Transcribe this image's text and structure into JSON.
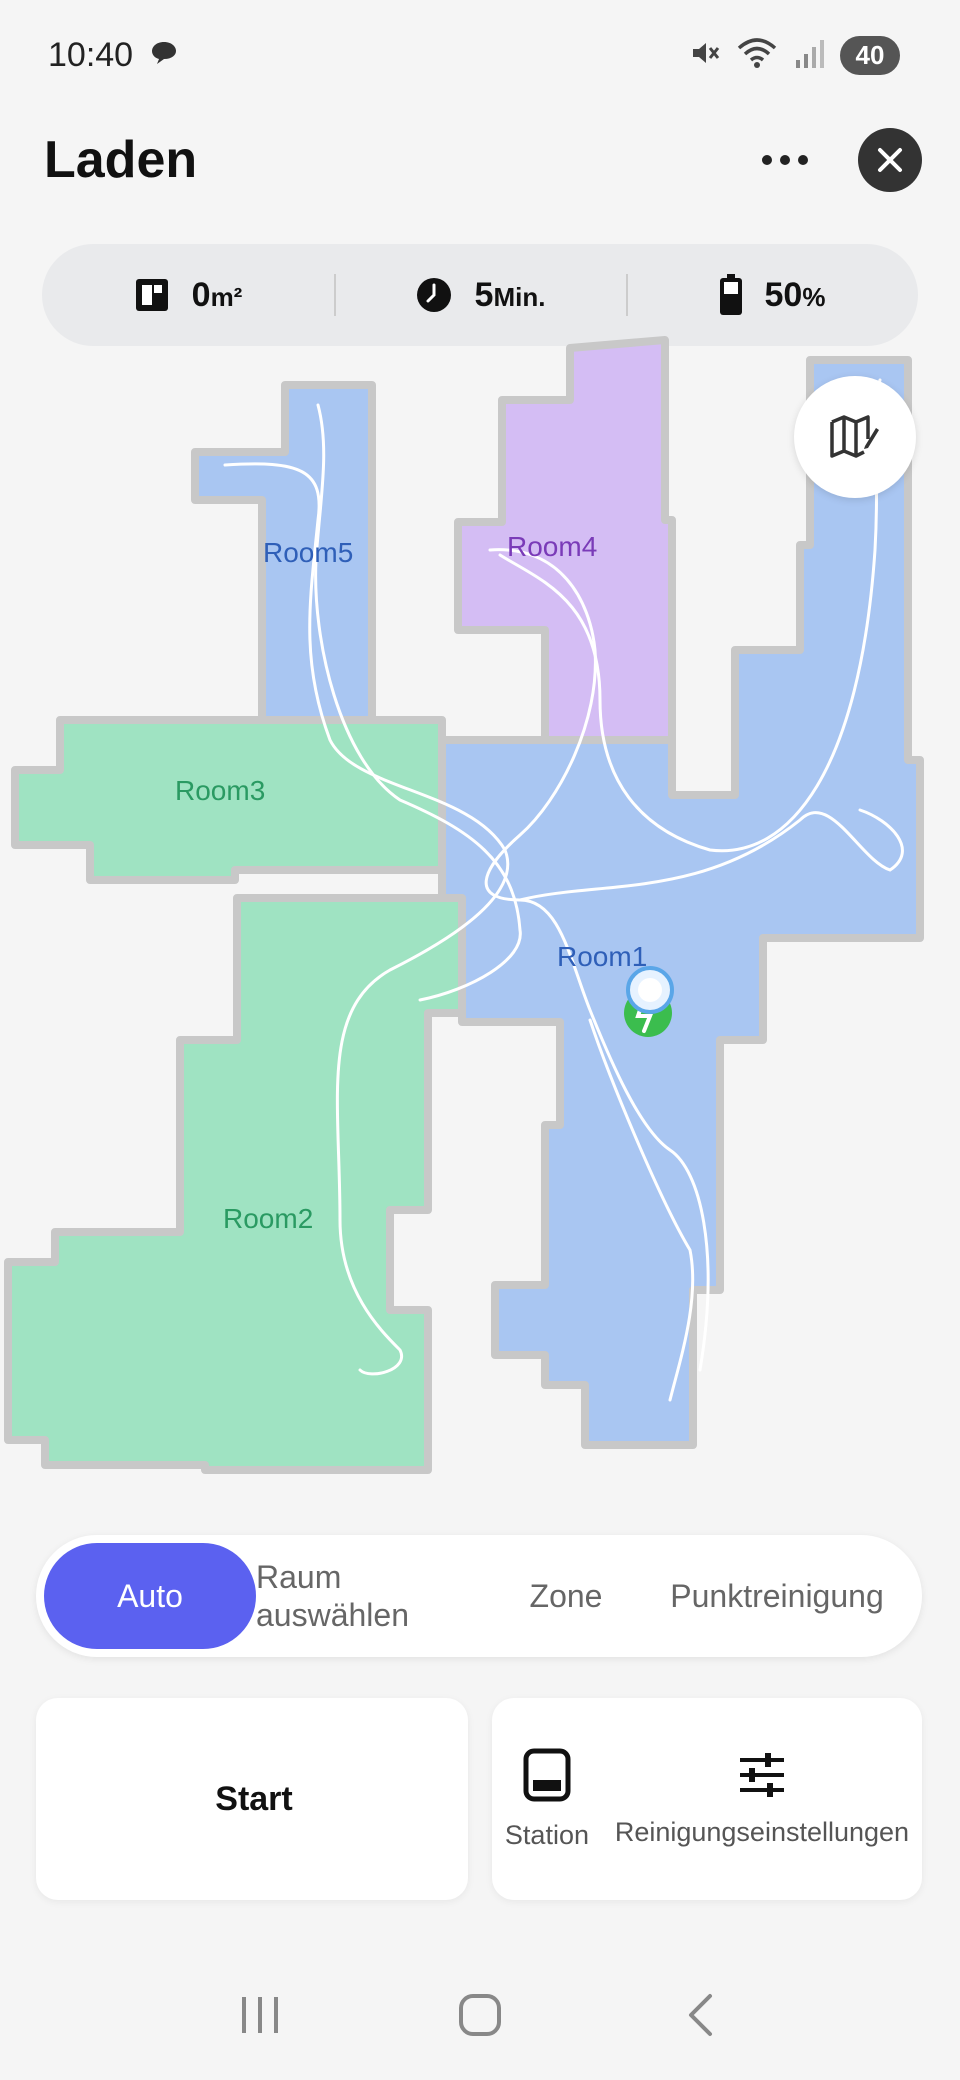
{
  "status_bar": {
    "time": "10:40",
    "battery_level": "40",
    "icons": [
      "chat-bubble-icon",
      "mute-icon",
      "wifi-icon",
      "signal-icon"
    ]
  },
  "header": {
    "title": "Laden",
    "more_icon": "more-dots-icon",
    "close_icon": "close-icon"
  },
  "stats": {
    "area": {
      "value": "0",
      "unit": "m²",
      "icon": "area-icon"
    },
    "time": {
      "value": "5",
      "unit": "Min.",
      "icon": "clock-icon"
    },
    "battery": {
      "value": "50",
      "unit": "%",
      "icon": "battery-icon"
    }
  },
  "map": {
    "rooms": [
      {
        "name": "Room1",
        "color": "#a9c6f2",
        "label_color": "#2f5fb8"
      },
      {
        "name": "Room2",
        "color": "#9fe3c2",
        "label_color": "#2a9a62"
      },
      {
        "name": "Room3",
        "color": "#9fe3c2",
        "label_color": "#2a9a62"
      },
      {
        "name": "Room4",
        "color": "#d4bdf4",
        "label_color": "#7a3bb8"
      },
      {
        "name": "Room5",
        "color": "#a9c6f2",
        "label_color": "#2f5fb8"
      }
    ],
    "edit_icon": "map-edit-icon"
  },
  "mode_tabs": {
    "auto": "Auto",
    "raum_line1": "Raum",
    "raum_line2": "auswählen",
    "zone": "Zone",
    "punkt": "Punktreinigung",
    "active": "Auto",
    "accent_color": "#5b61f0"
  },
  "actions": {
    "start": "Start",
    "station": "Station",
    "settings": "Reinigungseinstellungen"
  },
  "navbar": {
    "recents_icon": "recents-icon",
    "home_icon": "home-icon",
    "back_icon": "back-icon"
  }
}
